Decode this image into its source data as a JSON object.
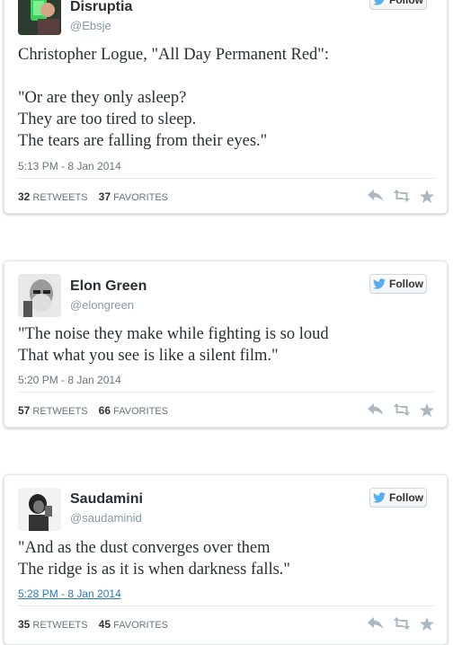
{
  "follow_label": "Follow",
  "stats_labels": {
    "retweets": "RETWEETS",
    "favorites": "FAVORITES"
  },
  "tweets": [
    {
      "name": "Disruptia",
      "handle": "@Ebsje",
      "lines": [
        "Christopher Logue, \"All Day Permanent Red\":",
        "",
        "\"Or are they only asleep?",
        "They are too tired to sleep.",
        "The tears are falling from their eyes.\""
      ],
      "timestamp": "5:13 PM - 8 Jan 2014",
      "retweets": "32",
      "favorites": "37"
    },
    {
      "name": "Elon Green",
      "handle": "@elongreen",
      "lines": [
        "\"The noise they make while fighting is so loud",
        "That what you see is like a silent film.\""
      ],
      "timestamp": "5:20 PM - 8 Jan 2014",
      "retweets": "57",
      "favorites": "66"
    },
    {
      "name": "Saudamini",
      "handle": "@saudaminid",
      "lines": [
        "\"And as the dust converges over them",
        "The ridge is as it is when darkness falls.\""
      ],
      "timestamp": "5:28 PM - 8 Jan 2014",
      "retweets": "35",
      "favorites": "45"
    }
  ],
  "colors": {
    "twitter_blue": "#55acee",
    "link_blue": "#2b7bb9",
    "icon_grey": "#aab8c2"
  }
}
